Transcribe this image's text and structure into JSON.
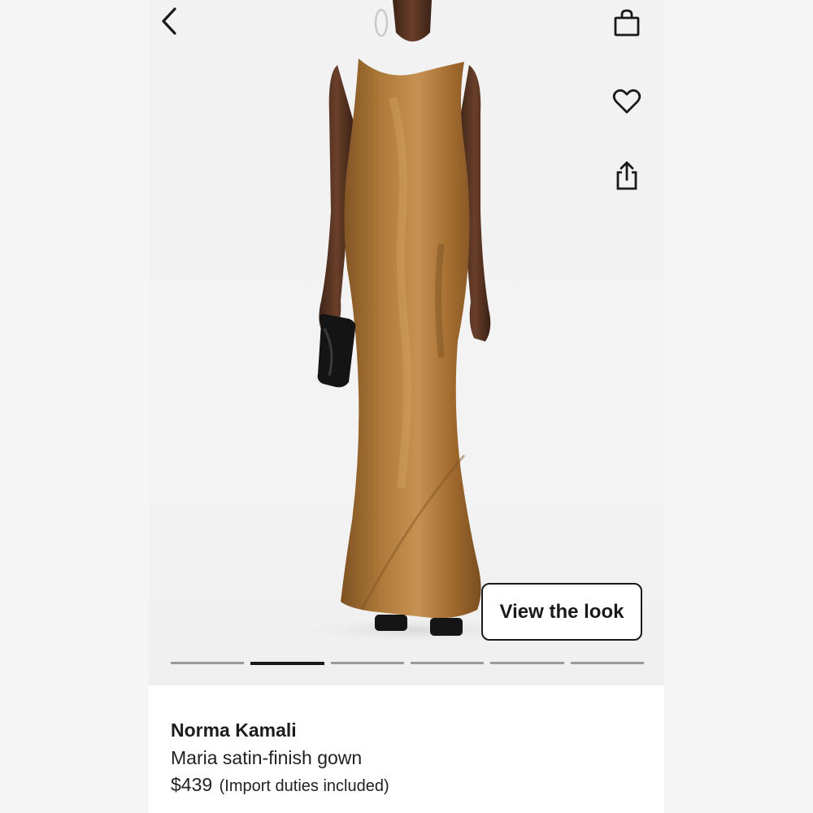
{
  "gallery": {
    "view_look_label": "View the look",
    "page_count": 6,
    "active_page": 2
  },
  "product": {
    "brand": "Norma Kamali",
    "name": "Maria satin-finish gown",
    "price": "$439",
    "duties_note": "(Import duties included)"
  },
  "icons": {
    "back": "chevron-left-icon",
    "bag": "shopping-bag-icon",
    "wishlist": "heart-icon",
    "share": "share-icon"
  },
  "colors": {
    "dress": "#a06f32",
    "accent": "#1a1a1a",
    "pager_inactive": "#9a9a9a"
  }
}
